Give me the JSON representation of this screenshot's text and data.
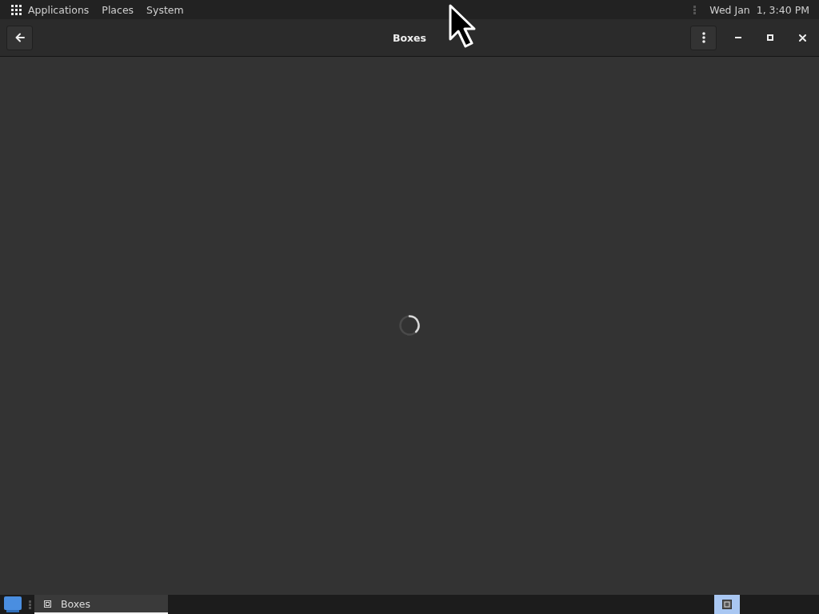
{
  "top_panel": {
    "menus": [
      {
        "label": "Applications"
      },
      {
        "label": "Places"
      },
      {
        "label": "System"
      }
    ],
    "clock": "Wed Jan  1, 3:40 PM"
  },
  "window": {
    "title": "Boxes",
    "loading": true
  },
  "taskbar": {
    "tasks": [
      {
        "label": "Boxes",
        "selected": true
      }
    ],
    "workspaces": [
      {
        "selected": true
      }
    ]
  }
}
